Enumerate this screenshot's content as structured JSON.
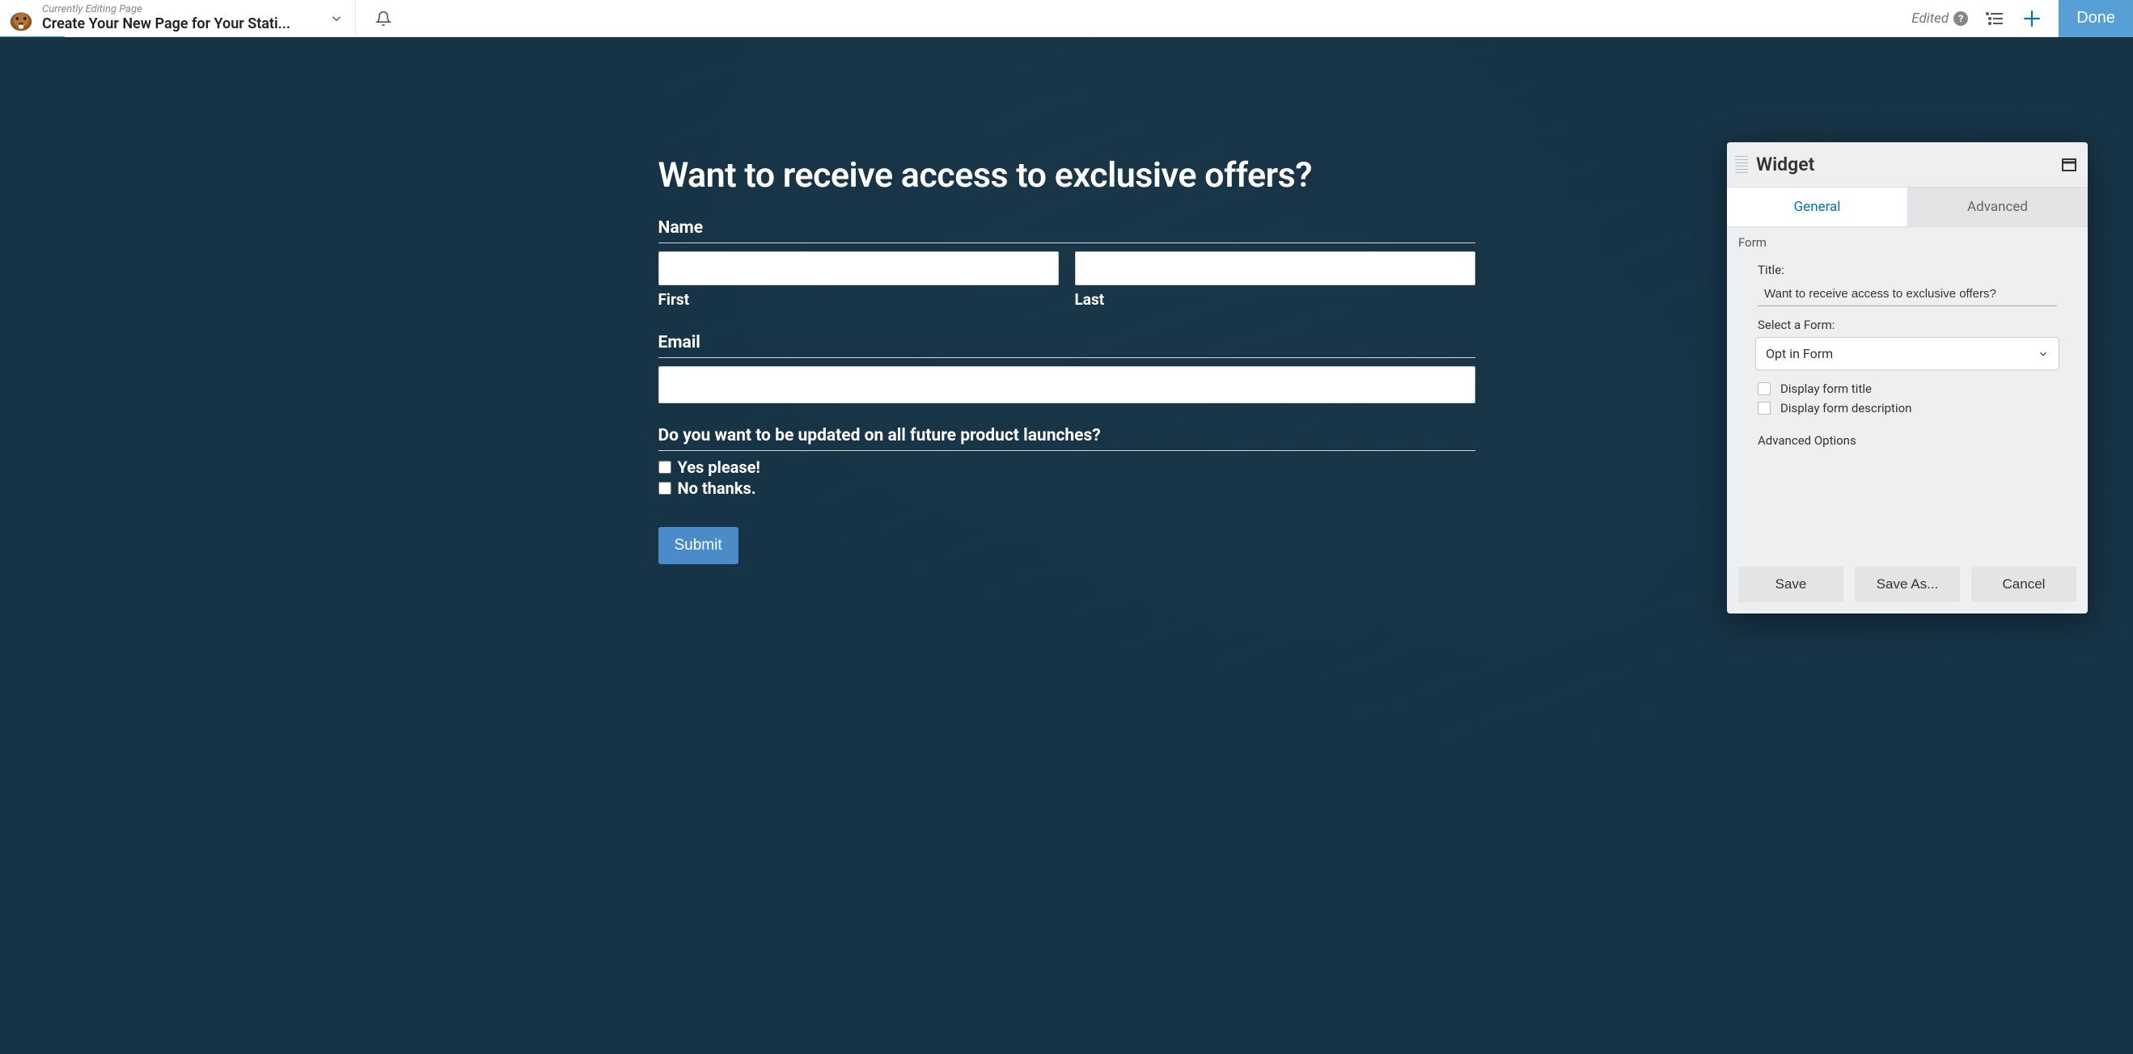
{
  "header": {
    "label": "Currently Editing Page",
    "title": "Create Your New Page for Your Stati...",
    "edited": "Edited",
    "done": "Done"
  },
  "form": {
    "heading": "Want to receive access to exclusive offers?",
    "name_label": "Name",
    "first_label": "First",
    "last_label": "Last",
    "email_label": "Email",
    "question": "Do you want to be updated on all future product launches?",
    "option_yes": "Yes please!",
    "option_no": "No thanks.",
    "submit": "Submit"
  },
  "widget": {
    "title": "Widget",
    "tabs": {
      "general": "General",
      "advanced": "Advanced"
    },
    "section": "Form",
    "title_label": "Title:",
    "title_value": "Want to receive access to exclusive offers?",
    "select_label": "Select a Form:",
    "select_value": "Opt in Form",
    "display_title": "Display form title",
    "display_desc": "Display form description",
    "advanced_options": "Advanced Options",
    "buttons": {
      "save": "Save",
      "saveas": "Save As...",
      "cancel": "Cancel"
    }
  }
}
